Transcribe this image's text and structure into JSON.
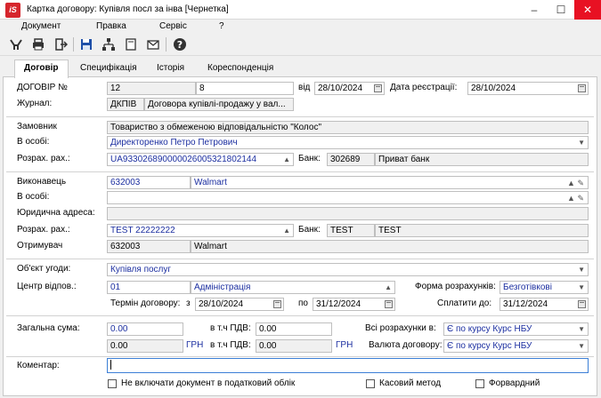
{
  "titlebar": {
    "logo": "iS",
    "title": "Картка договору:  Купівля посл за інва  [Чернетка]"
  },
  "menu": [
    "Документ",
    "Правка",
    "Сервіс",
    "?"
  ],
  "toolbar": [
    "filter-icon",
    "print-icon",
    "exit-icon",
    "save-icon",
    "tree-icon",
    "document-icon",
    "mail-icon",
    "help-icon"
  ],
  "tabs": [
    "Договір",
    "Специфікація",
    "Історія",
    "Кореспонденція"
  ],
  "contract": {
    "number_label": "ДОГОВІР №",
    "number_prefix": "12",
    "number": "8",
    "from_label": "від",
    "date": "28/10/2024",
    "reg_label": "Дата реєстрації:",
    "reg_date": "28/10/2024",
    "journal_label": "Журнал:",
    "journal_code": "ДКПІВ",
    "journal_name": "Договора купівлі-продажу у вал..."
  },
  "customer": {
    "label": "Замовник",
    "name": "Товариство з обмеженою відповідальністю \"Колос\"",
    "person_label": "В особі:",
    "person": "Директоренко Петро Петрович",
    "account_label": "Розрах. рах.:",
    "account": "UA933026890000026005321802144",
    "bank_label": "Банк:",
    "bank_code": "302689",
    "bank_name": "Приват банк"
  },
  "executor": {
    "label": "Виконавець",
    "code": "632003",
    "name": "Walmart",
    "person_label": "В особі:",
    "person": "",
    "address_label": "Юридична адреса:",
    "address": "",
    "account_label": "Розрах. рах.:",
    "account": "TEST 22222222",
    "bank_label": "Банк:",
    "bank_code": "TEST",
    "bank_name": "TEST",
    "receiver_label": "Отримувач",
    "receiver_code": "632003",
    "receiver_name": "Walmart"
  },
  "subject": {
    "label": "Об'єкт угоди:",
    "value": "Купівля послуг",
    "center_label": "Центр відпов.:",
    "center_code": "01",
    "center_name": "Адміністрація",
    "payform_label": "Форма розрахунків:",
    "payform": "Безготівкові",
    "term_label": "Термін договору:",
    "from_label": "з",
    "term_from": "28/10/2024",
    "to_label": "по",
    "term_to": "31/12/2024",
    "pay_until_label": "Сплатити до:",
    "pay_until": "31/12/2024"
  },
  "amounts": {
    "total_label": "Загальна сума:",
    "total": "0.00",
    "total_uah": "0.00",
    "uah_label": "ГРН",
    "vat_label": "в т.ч ПДВ:",
    "vat": "0.00",
    "vat_uah": "0.00",
    "uah_label2": "ГРН",
    "all_calc_label": "Всі розрахунки в:",
    "all_calc": "Є по курсу Курс НБУ",
    "currency_label": "Валюта договору:",
    "currency": "Є по курсу Курс НБУ"
  },
  "comment": {
    "label": "Коментар:",
    "value": ""
  },
  "checks": {
    "tax": "Не включати документ в податковий облік",
    "cash": "Касовий метод",
    "forward": "Форвардний"
  }
}
